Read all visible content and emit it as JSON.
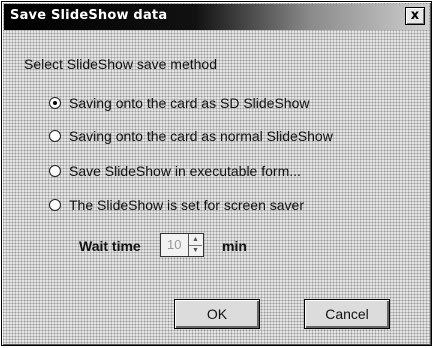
{
  "window": {
    "title": "Save SlideShow data",
    "close_label": "x"
  },
  "group": {
    "label": "Select SlideShow save method"
  },
  "options": [
    {
      "label": "Saving onto the card as SD SlideShow",
      "checked": true
    },
    {
      "label": "Saving onto the card as normal SlideShow",
      "checked": false
    },
    {
      "label": "Save SlideShow in executable form...",
      "checked": false
    },
    {
      "label": "The SlideShow is set for screen saver",
      "checked": false
    }
  ],
  "wait": {
    "label": "Wait time",
    "value": "10",
    "unit": "min",
    "up_arrow": "▲",
    "down_arrow": "▼"
  },
  "buttons": {
    "ok_label": "OK",
    "cancel_label": "Cancel"
  }
}
